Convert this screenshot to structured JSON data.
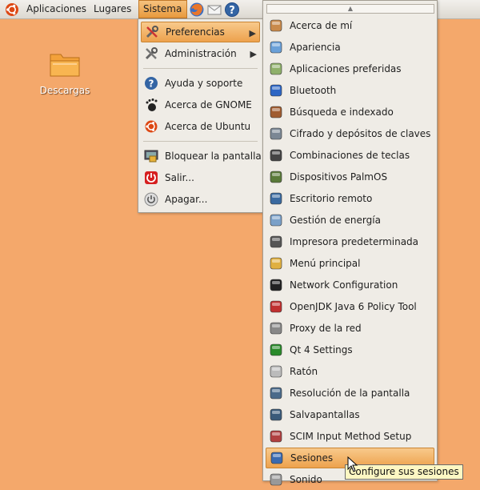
{
  "panel": {
    "applications": "Aplicaciones",
    "places": "Lugares",
    "system": "Sistema"
  },
  "desktop": {
    "downloads": "Descargas"
  },
  "system_menu": {
    "preferences": "Preferencias",
    "administration": "Administración",
    "help": "Ayuda y soporte",
    "about_gnome": "Acerca de GNOME",
    "about_ubuntu": "Acerca de Ubuntu",
    "lock_screen": "Bloquear la pantalla",
    "logout": "Salir...",
    "shutdown": "Apagar..."
  },
  "pref_menu": {
    "items": [
      {
        "label": "Acerca de mí",
        "icon": "about-me-icon"
      },
      {
        "label": "Apariencia",
        "icon": "appearance-icon"
      },
      {
        "label": "Aplicaciones preferidas",
        "icon": "preferred-apps-icon"
      },
      {
        "label": "Bluetooth",
        "icon": "bluetooth-icon"
      },
      {
        "label": "Búsqueda e indexado",
        "icon": "search-indexing-icon"
      },
      {
        "label": "Cifrado y depósitos de claves",
        "icon": "encryption-icon"
      },
      {
        "label": "Combinaciones de teclas",
        "icon": "keyboard-shortcuts-icon"
      },
      {
        "label": "Dispositivos PalmOS",
        "icon": "palm-device-icon"
      },
      {
        "label": "Escritorio remoto",
        "icon": "remote-desktop-icon"
      },
      {
        "label": "Gestión de energía",
        "icon": "power-management-icon"
      },
      {
        "label": "Impresora predeterminada",
        "icon": "printer-icon"
      },
      {
        "label": "Menú principal",
        "icon": "main-menu-icon"
      },
      {
        "label": "Network Configuration",
        "icon": "network-icon"
      },
      {
        "label": "OpenJDK Java 6 Policy Tool",
        "icon": "java-policy-icon"
      },
      {
        "label": "Proxy de la red",
        "icon": "network-proxy-icon"
      },
      {
        "label": "Qt 4 Settings",
        "icon": "qt-settings-icon"
      },
      {
        "label": "Ratón",
        "icon": "mouse-icon"
      },
      {
        "label": "Resolución de la pantalla",
        "icon": "screen-resolution-icon"
      },
      {
        "label": "Salvapantallas",
        "icon": "screensaver-icon"
      },
      {
        "label": "SCIM Input Method Setup",
        "icon": "scim-icon"
      },
      {
        "label": "Sesiones",
        "icon": "sessions-icon"
      },
      {
        "label": "Sonido",
        "icon": "sound-icon"
      }
    ]
  },
  "tooltip": "Configure sus sesiones",
  "colors": {
    "desktop": "#f4a86b",
    "highlight": "#eda24d",
    "menu_bg": "#efece6"
  }
}
